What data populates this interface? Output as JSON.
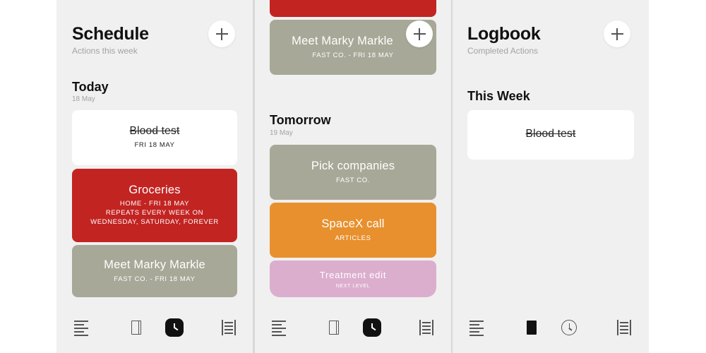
{
  "screens": {
    "schedule": {
      "title": "Schedule",
      "subtitle": "Actions this week",
      "sections": {
        "today": {
          "title": "Today",
          "date": "18 May",
          "cards": [
            {
              "title": "Blood test",
              "sub": "FRI 18 MAY",
              "style": "completed"
            },
            {
              "title": "Groceries",
              "sub": "HOME - FRI 18 MAY\nREPEATS EVERY WEEK ON\nWEDNESDAY, SATURDAY, FOREVER",
              "color": "#c22422"
            },
            {
              "title": "Meet Marky Markle",
              "sub": "FAST CO. - FRI 18 MAY",
              "color": "#a8a898"
            }
          ]
        }
      }
    },
    "schedule_scrolled": {
      "cards_top": [
        {
          "title": "Meet Marky Markle",
          "sub": "FAST CO. - FRI 18 MAY",
          "color": "#a8a898"
        }
      ],
      "sections": {
        "tomorrow": {
          "title": "Tomorrow",
          "date": "19 May",
          "cards": [
            {
              "title": "Pick companies",
              "sub": "FAST CO.",
              "color": "#a8a898"
            },
            {
              "title": "SpaceX call",
              "sub": "ARTICLES",
              "color": "#e8902e"
            },
            {
              "title": "Treatment edit",
              "sub": "NEXT LEVEL",
              "color": "#dcaece"
            }
          ]
        }
      }
    },
    "logbook": {
      "title": "Logbook",
      "subtitle": "Completed Actions",
      "sections": {
        "this_week": {
          "title": "This Week",
          "cards": [
            {
              "title": "Blood test",
              "style": "completed"
            }
          ]
        }
      }
    }
  },
  "tab_bar": {
    "icons": [
      "list-icon",
      "book-icon",
      "clock-icon",
      "archive-icon"
    ],
    "active_schedule": "clock-icon",
    "active_logbook": "book-icon"
  },
  "colors": {
    "background": "#f0f0f0",
    "red": "#c22422",
    "olive": "#a8a898",
    "orange": "#e8902e",
    "pink": "#dcaece"
  }
}
